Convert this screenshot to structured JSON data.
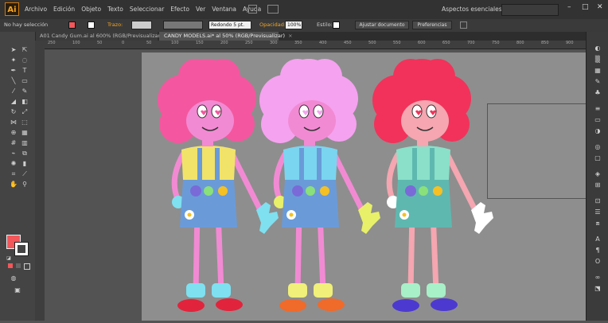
{
  "app": {
    "logo": "Ai"
  },
  "menu": [
    "Archivo",
    "Edición",
    "Objeto",
    "Texto",
    "Seleccionar",
    "Efecto",
    "Ver",
    "Ventana",
    "Ayuda"
  ],
  "workspace": {
    "label": "Aspectos esenciales",
    "arrow": "▾"
  },
  "window_controls": {
    "minimize": "–",
    "maximize": "□",
    "close": "✕"
  },
  "control_bar": {
    "selection_label": "No hay selección",
    "stroke_label": "Trazo:",
    "brush_value": "Redondo 5 pt.",
    "opacity_label": "Opacidad:",
    "opacity_value": "100%",
    "style_label": "Estilo:",
    "adjust_button": "Ajustar documento",
    "prefs_button": "Preferencias"
  },
  "tabs": [
    {
      "label": "A01 Candy Gum.ai al 600% (RGB/Previsualizar)",
      "close": "×",
      "active": false
    },
    {
      "label": "CANDY MODELS.ai* al 50% (RGB/Previsualizar)",
      "close": "×",
      "active": true
    }
  ],
  "ruler_ticks": [
    "250",
    "100",
    "50",
    "0",
    "50",
    "100",
    "150",
    "200",
    "250",
    "300",
    "350",
    "400",
    "450",
    "500",
    "550",
    "600",
    "650",
    "700",
    "750",
    "800",
    "850",
    "900"
  ],
  "colors": {
    "fill": "#f2575a",
    "stroke": "#ffffff",
    "artboard": "#8e8e8e",
    "app_bg": "#535353",
    "accent": "#f5a623"
  },
  "characters": [
    {
      "name_id": "pink",
      "hair": "#f4579f",
      "shirt": "#f1e36a",
      "overalls": "#6a9bd8",
      "gloves": "#7fe0f0",
      "shoes": "#e2233c",
      "socks": "#7fe0f0",
      "skin": "#f28ad3"
    },
    {
      "name_id": "lavender",
      "hair": "#f5a2f0",
      "shirt": "#7ad5f0",
      "overalls": "#6a9bd8",
      "gloves": "#e8f06a",
      "shoes": "#f06a2a",
      "socks": "#f0f07a",
      "skin": "#f28ad3"
    },
    {
      "name_id": "red",
      "hair": "#f2325a",
      "shirt": "#8ae0c8",
      "overalls": "#5fb8b0",
      "gloves": "#ffffff",
      "shoes": "#4c3ad0",
      "socks": "#a8f0c8",
      "skin": "#f5a6b0"
    }
  ]
}
